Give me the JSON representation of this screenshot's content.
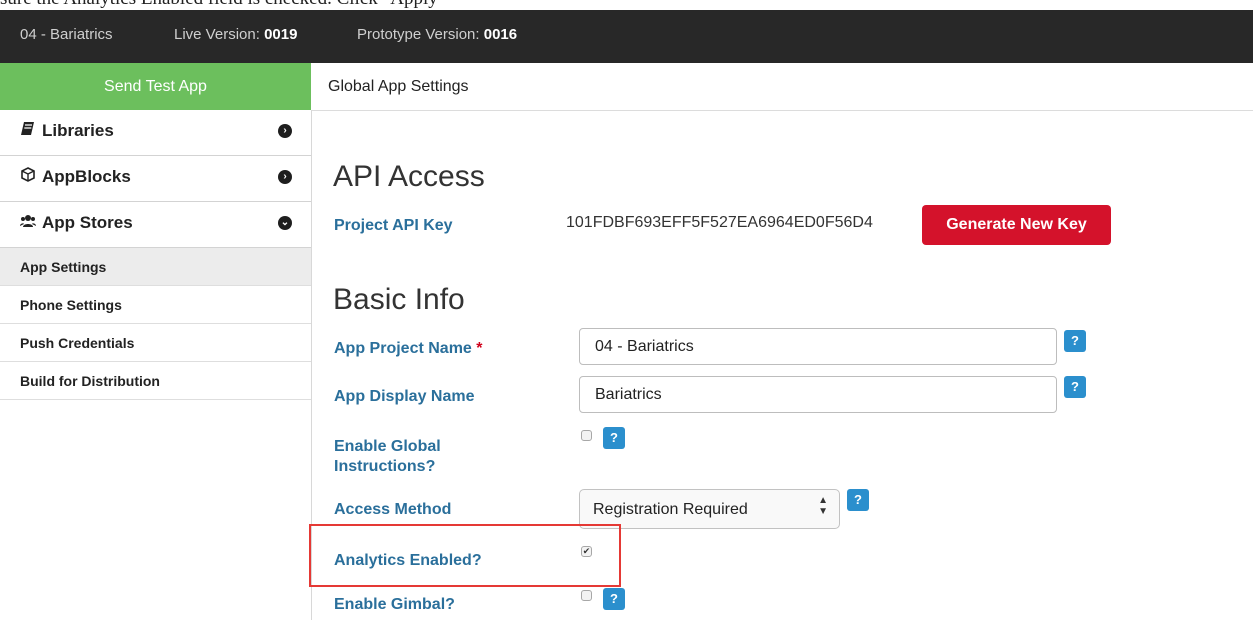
{
  "caption": "sure the Analytics Enabled field is checked. Click \"Apply\"",
  "topbar": {
    "project": "04 - Bariatrics",
    "live_label": "Live Version:",
    "live_value": "0019",
    "proto_label": "Prototype Version:",
    "proto_value": "0016"
  },
  "send_test_app": "Send Test App",
  "sidebar": {
    "sections": [
      {
        "label": "Libraries",
        "icon": "book-icon",
        "chevron": "chevron-right-icon"
      },
      {
        "label": "AppBlocks",
        "icon": "cube-icon",
        "chevron": "chevron-right-icon"
      },
      {
        "label": "App Stores",
        "icon": "users-icon",
        "chevron": "chevron-down-icon"
      }
    ],
    "items": [
      {
        "label": "App Settings",
        "active": true
      },
      {
        "label": "Phone Settings",
        "active": false
      },
      {
        "label": "Push Credentials",
        "active": false
      },
      {
        "label": "Build for Distribution",
        "active": false
      }
    ]
  },
  "header": {
    "title": "Global App Settings"
  },
  "api_access": {
    "heading": "API Access",
    "key_label": "Project API Key",
    "key_value": "101FDBF693EFF5F527EA6964ED0F56D4",
    "generate_label": "Generate New Key"
  },
  "basic_info": {
    "heading": "Basic Info",
    "project_name_label": "App Project Name",
    "required_mark": "*",
    "project_name_value": "04 - Bariatrics",
    "display_name_label": "App Display Name",
    "display_name_value": "Bariatrics",
    "global_instr_label_1": "Enable Global",
    "global_instr_label_2": "Instructions?",
    "global_instr_checked": false,
    "access_method_label": "Access Method",
    "access_method_value": "Registration Required",
    "analytics_label": "Analytics Enabled?",
    "analytics_checked": true,
    "gimbal_label": "Enable Gimbal?",
    "gimbal_checked": false,
    "help_glyph": "?"
  },
  "colors": {
    "accent_green": "#6cbf5d",
    "label_blue": "#2a6f9b",
    "danger_red": "#d4122b",
    "help_blue": "#2b8fcd",
    "highlight_red": "#e53935"
  }
}
